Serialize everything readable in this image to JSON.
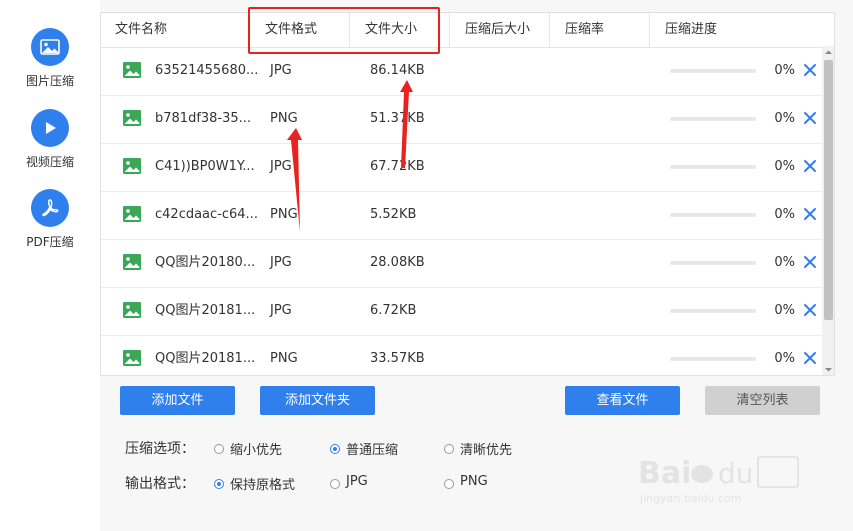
{
  "sidebar": {
    "items": [
      {
        "label": "图片压缩",
        "icon": "image-icon"
      },
      {
        "label": "视频压缩",
        "icon": "play-icon"
      },
      {
        "label": "PDF压缩",
        "icon": "pdf-icon"
      }
    ]
  },
  "table": {
    "headers": {
      "name": "文件名称",
      "format": "文件格式",
      "size": "文件大小",
      "compressed_size": "压缩后大小",
      "ratio": "压缩率",
      "progress": "压缩进度"
    },
    "rows": [
      {
        "name": "63521455680...",
        "format": "JPG",
        "size": "86.14KB",
        "progress": 0,
        "pct": "0%"
      },
      {
        "name": "b781df38-35...",
        "format": "PNG",
        "size": "51.37KB",
        "progress": 0,
        "pct": "0%"
      },
      {
        "name": "C41))BP0W1Y...",
        "format": "JPG",
        "size": "67.72KB",
        "progress": 0,
        "pct": "0%"
      },
      {
        "name": "c42cdaac-c64...",
        "format": "PNG",
        "size": "5.52KB",
        "progress": 0,
        "pct": "0%"
      },
      {
        "name": "QQ图片20180...",
        "format": "JPG",
        "size": "28.08KB",
        "progress": 0,
        "pct": "0%"
      },
      {
        "name": "QQ图片20181...",
        "format": "JPG",
        "size": "6.72KB",
        "progress": 0,
        "pct": "0%"
      },
      {
        "name": "QQ图片20181...",
        "format": "PNG",
        "size": "33.57KB",
        "progress": 0,
        "pct": "0%"
      }
    ]
  },
  "buttons": {
    "add_file": "添加文件",
    "add_folder": "添加文件夹",
    "view_files": "查看文件",
    "clear_list": "清空列表"
  },
  "options": {
    "compress_label": "压缩选项：",
    "compress_choices": [
      "缩小优先",
      "普通压缩",
      "清晰优先"
    ],
    "compress_selected": "普通压缩",
    "format_label": "输出格式：",
    "format_choices": [
      "保持原格式",
      "JPG",
      "PNG"
    ],
    "format_selected": "保持原格式"
  },
  "colors": {
    "accent": "#2f80ed",
    "highlight": "#e8231f",
    "file_icon": "#3aa757"
  }
}
